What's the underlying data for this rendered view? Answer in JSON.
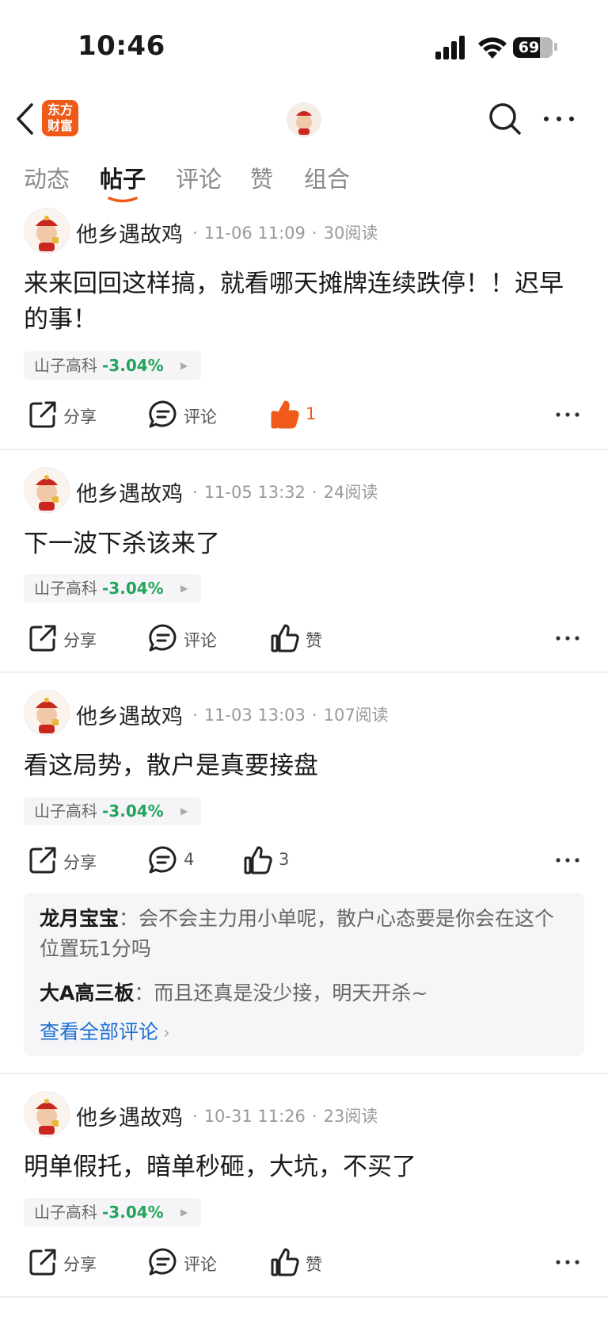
{
  "status_bar": {
    "time": "10:46",
    "battery": "69"
  },
  "header": {
    "logo_line1": "东方",
    "logo_line2": "财富"
  },
  "tabs": [
    {
      "label": "动态",
      "active": false
    },
    {
      "label": "帖子",
      "active": true
    },
    {
      "label": "评论",
      "active": false
    },
    {
      "label": "赞",
      "active": false
    },
    {
      "label": "组合",
      "active": false
    }
  ],
  "posts": [
    {
      "author": "他乡遇故鸡",
      "time": "11-06 11:09",
      "reads": "30阅读",
      "content": "来来回回这样搞，就看哪天摊牌连续跌停！！迟早的事！",
      "stock": {
        "name": "山子高科",
        "change": "-3.04%"
      },
      "actions": {
        "share": "分享",
        "comment": "评论",
        "like": "1"
      }
    },
    {
      "author": "他乡遇故鸡",
      "time": "11-05 13:32",
      "reads": "24阅读",
      "content": "下一波下杀该来了",
      "stock": {
        "name": "山子高科",
        "change": "-3.04%"
      },
      "actions": {
        "share": "分享",
        "comment": "评论",
        "like": "赞"
      }
    },
    {
      "author": "他乡遇故鸡",
      "time": "11-03 13:03",
      "reads": "107阅读",
      "content": "看这局势，散户是真要接盘",
      "stock": {
        "name": "山子高科",
        "change": "-3.04%"
      },
      "actions": {
        "share": "分享",
        "comment": "4",
        "like": "3"
      },
      "comments": [
        {
          "user": "龙月宝宝",
          "sep": "：",
          "text": "会不会主力用小单呢，散户心态要是你会在这个位置玩1分吗"
        },
        {
          "user": "大A高三板",
          "sep": "：",
          "text": "而且还真是没少接，明天开杀~"
        }
      ],
      "view_all": "查看全部评论"
    },
    {
      "author": "他乡遇故鸡",
      "time": "10-31 11:26",
      "reads": "23阅读",
      "content": "明单假托，暗单秒砸，大坑，不买了",
      "stock": {
        "name": "山子高科",
        "change": "-3.04%"
      },
      "actions": {
        "share": "分享",
        "comment": "评论",
        "like": "赞"
      }
    }
  ],
  "colors": {
    "accent": "#ef5a18",
    "stock_down": "#23a45b",
    "link": "#1c6fd3"
  },
  "icons": [
    "back-icon",
    "search-icon",
    "more-icon",
    "share-icon",
    "comment-icon",
    "thumbs-up-icon",
    "chevron-right-icon"
  ]
}
